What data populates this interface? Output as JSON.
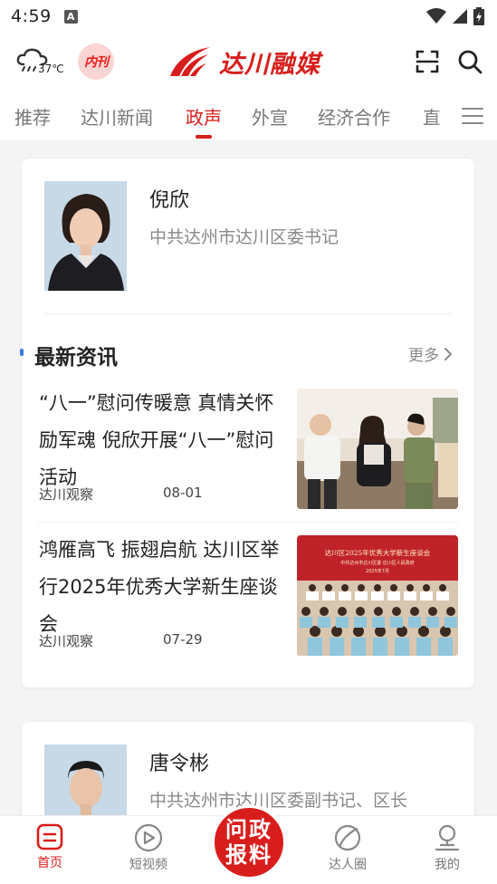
{
  "status_bar": {
    "time": "4:59",
    "notification_glyph": "A"
  },
  "header": {
    "weather_temp": "37℃",
    "neikan_label": "内刊",
    "logo_text": "达川融媒",
    "brand_color": "#d81e1c"
  },
  "tabs": [
    {
      "label": "推荐",
      "active": false
    },
    {
      "label": "达川新闻",
      "active": false
    },
    {
      "label": "政声",
      "active": true
    },
    {
      "label": "外宣",
      "active": false
    },
    {
      "label": "经济合作",
      "active": false
    },
    {
      "label": "直",
      "active": false
    }
  ],
  "leader_1": {
    "name": "倪欣",
    "title": "中共达州市达川区委书记"
  },
  "latest_news": {
    "section_title": "最新资讯",
    "more_label": "更多",
    "items": [
      {
        "title": "“八一”慰问传暖意 真情关怀励军魂 倪欣开展“八一”慰问活动",
        "source": "达川观察",
        "date": "08-01"
      },
      {
        "title": "鸿雁高飞 振翅启航 达川区举行2025年优秀大学新生座谈会",
        "source": "达川观察",
        "date": "07-29",
        "banner_line_1": "达川区2025年优秀大学新生座谈会",
        "banner_line_2": "中共达州市达川区委  达川区人民政府",
        "banner_line_3": "2025年7月"
      }
    ]
  },
  "leader_2": {
    "name": "唐令彬",
    "title": "中共达州市达川区委副书记、区长"
  },
  "bottom_nav": {
    "items": [
      {
        "label": "首页",
        "icon": "home-icon",
        "active": true
      },
      {
        "label": "短视频",
        "icon": "play-icon",
        "active": false
      },
      {
        "label": "达人圈",
        "icon": "circle-icon",
        "active": false
      },
      {
        "label": "我的",
        "icon": "profile-icon",
        "active": false
      }
    ],
    "center_line_1": "问政",
    "center_line_2": "报料"
  }
}
